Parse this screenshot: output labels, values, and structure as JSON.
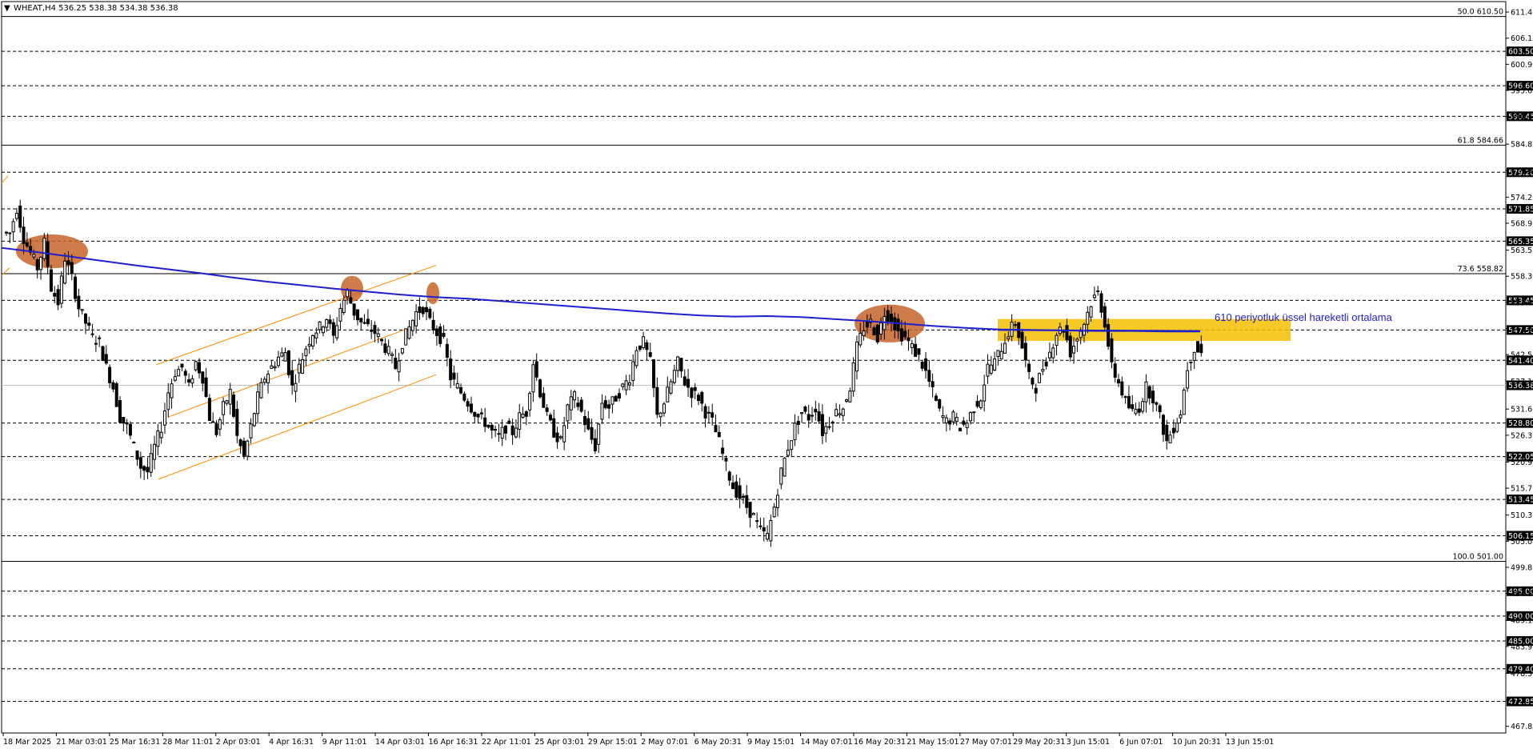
{
  "header": {
    "symbol_line": "WHEAT,H4  536.25 538.38 534.38 536.38"
  },
  "colors": {
    "background": "#ffffff",
    "candles": "#000000",
    "ema_line": "#1f1fd0",
    "channel": "#ff8c00",
    "touch_marks": "#c8642a",
    "highlight_zone": "#f5c000",
    "annotation_text": "#1f1fd0"
  },
  "chart_data": {
    "type": "candlestick",
    "symbol": "WHEAT",
    "timeframe": "H4",
    "ohlc_last": {
      "open": 536.25,
      "high": 538.38,
      "low": 534.38,
      "close": 536.38
    },
    "current_price_label": "536.38",
    "ylim": [
      466.5,
      613.5
    ],
    "y_ticks": [
      "611.40",
      "606.15",
      "600.90",
      "595.65",
      "590.40",
      "584.85",
      "579.60",
      "574.20",
      "568.95",
      "563.55",
      "558.30",
      "553.05",
      "547.80",
      "542.55",
      "537.15",
      "531.60",
      "526.35",
      "520.95",
      "515.70",
      "510.30",
      "505.05",
      "499.80",
      "494.55",
      "489.15",
      "483.90",
      "478.50",
      "473.10",
      "467.85"
    ],
    "x_labels": [
      "18 Mar 2025",
      "21 Mar 03:01",
      "25 Mar 16:31",
      "28 Mar 11:01",
      "2 Apr 03:01",
      "4 Apr 16:31",
      "9 Apr 11:01",
      "14 Apr 03:01",
      "16 Apr 16:31",
      "22 Apr 11:01",
      "25 Apr 03:01",
      "29 Apr 15:01",
      "2 May 07:01",
      "6 May 20:31",
      "9 May 15:01",
      "14 May 07:01",
      "16 May 20:31",
      "21 May 15:01",
      "27 May 07:01",
      "29 May 20:31",
      "3 Jun 15:01",
      "6 Jun 07:01",
      "10 Jun 20:31",
      "13 Jun 15:01"
    ],
    "horizontal_levels": [
      {
        "value": 603.5,
        "label": "603.50"
      },
      {
        "value": 596.6,
        "label": "596.60"
      },
      {
        "value": 590.45,
        "label": "590.45"
      },
      {
        "value": 579.2,
        "label": "579.20"
      },
      {
        "value": 571.85,
        "label": "571.85"
      },
      {
        "value": 565.35,
        "label": "565.35"
      },
      {
        "value": 553.45,
        "label": "553.45"
      },
      {
        "value": 547.5,
        "label": "547.50"
      },
      {
        "value": 541.4,
        "label": "541.40"
      },
      {
        "value": 528.8,
        "label": "528.80"
      },
      {
        "value": 522.05,
        "label": "522.05"
      },
      {
        "value": 513.45,
        "label": "513.45"
      },
      {
        "value": 506.15,
        "label": "506.15"
      },
      {
        "value": 495.0,
        "label": "495.00"
      },
      {
        "value": 490.0,
        "label": "490.00"
      },
      {
        "value": 485.0,
        "label": "485.00"
      },
      {
        "value": 479.4,
        "label": "479.40"
      },
      {
        "value": 472.85,
        "label": "472.85"
      }
    ],
    "fibonacci_levels": [
      {
        "value": 610.5,
        "label": "50.0 610.50"
      },
      {
        "value": 584.66,
        "label": "61.8 584.66"
      },
      {
        "value": 558.82,
        "label": "73.6 558.82"
      },
      {
        "value": 501.0,
        "label": "100.0 501.00"
      }
    ],
    "annotation": {
      "text": "610 periyotluk üssel hareketli ortalama"
    },
    "ema_610": [
      564.0,
      563.2,
      562.3,
      561.4,
      560.5,
      559.7,
      558.9,
      558.0,
      557.2,
      556.5,
      555.8,
      555.2,
      554.6,
      554.1,
      553.8,
      553.3,
      552.8,
      552.3,
      551.8,
      551.3,
      550.8,
      550.4,
      550.2,
      550.3,
      550.1,
      549.7,
      549.3,
      548.8,
      548.3,
      547.9,
      547.6,
      547.5,
      547.4,
      547.3,
      547.3,
      547.2,
      547.2
    ],
    "candles_close_path": [
      567,
      572,
      566,
      563,
      560,
      565,
      556,
      553,
      562,
      558,
      552,
      549,
      546,
      545,
      540,
      536,
      530,
      528,
      524,
      520,
      519,
      524,
      528,
      535,
      539,
      540,
      536,
      541,
      538,
      530,
      527,
      532,
      535,
      526,
      522,
      528,
      534,
      538,
      540,
      542,
      543,
      536,
      540,
      544,
      547,
      548,
      550,
      546,
      552,
      555,
      551,
      549,
      548,
      547,
      545,
      543,
      540,
      545,
      548,
      551,
      552,
      549,
      547,
      545,
      538,
      536,
      534,
      532,
      530,
      529,
      527,
      526,
      528,
      527,
      530,
      531,
      541,
      535,
      530,
      527,
      525,
      532,
      534,
      531,
      527,
      524,
      533,
      532,
      534,
      536,
      538,
      544,
      545,
      541,
      530,
      533,
      537,
      541,
      537,
      535,
      534,
      531,
      529,
      525,
      520,
      516,
      514,
      512,
      510,
      507,
      506,
      512,
      519,
      524,
      528,
      531,
      530,
      532,
      527,
      529,
      531,
      532,
      536,
      544,
      548,
      549,
      546,
      551,
      550,
      547,
      546,
      544,
      542,
      539,
      535,
      531,
      529,
      530,
      528,
      529,
      532,
      534,
      540,
      541,
      544,
      547,
      549,
      544,
      538,
      536,
      540,
      543,
      547,
      548,
      543,
      546,
      549,
      553,
      555,
      549,
      540,
      537,
      533,
      531,
      532,
      536,
      534,
      530,
      525,
      528,
      531,
      540,
      544,
      543
    ]
  }
}
